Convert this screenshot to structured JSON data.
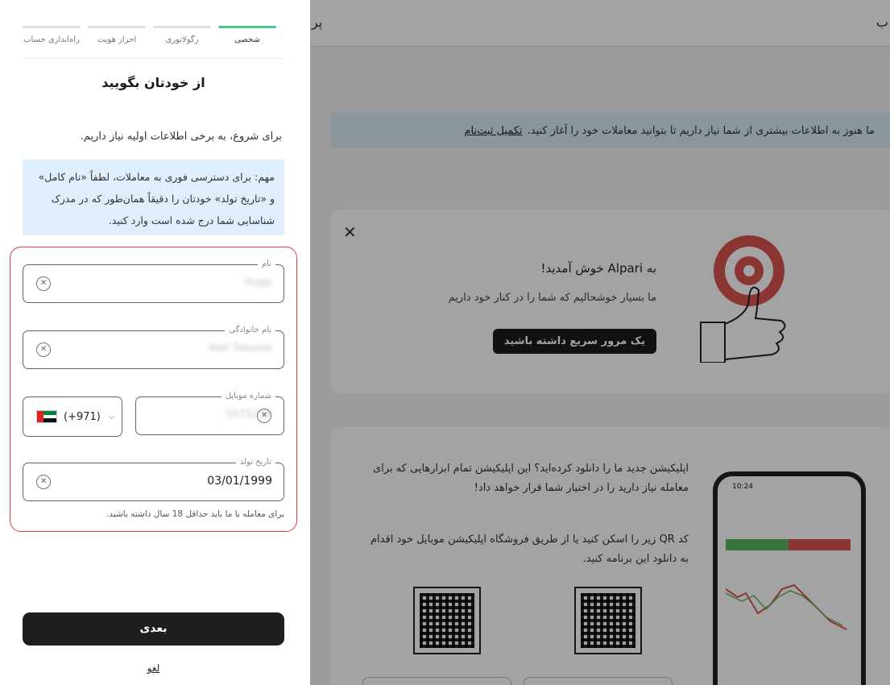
{
  "stepper": {
    "steps": [
      {
        "label": "شخصی",
        "active": true
      },
      {
        "label": "رگولاتوری",
        "active": false
      },
      {
        "label": "احراز هویت",
        "active": false
      },
      {
        "label": "راه‌اندازی حساب",
        "active": false
      }
    ],
    "accent": "#4cc98a"
  },
  "form": {
    "title": "از خودتان بگویید",
    "intro": "برای شروع، به برخی اطلاعات اولیه نیاز داریم.",
    "important_note": "مهم: برای دسترسی فوری به معاملات، لطفاً «نام کامل» و «تاریخ تولد» خودتان را دقیقاً همان‌طور که در مدرک شناسایی شما درج شده است وارد کنید.",
    "first_name": {
      "label": "نام",
      "value": "Hugo"
    },
    "last_name": {
      "label": "نام خانوادگی",
      "value": "Alef Tokooto"
    },
    "country_code": {
      "value": "(+971)",
      "flag": "uae-flag-icon"
    },
    "mobile": {
      "label": "شماره موبایل",
      "value": "5571234"
    },
    "dob": {
      "label": "تاریخ تولد",
      "value": "03/01/1999"
    },
    "age_note": "برای معامله با ما باید حداقل 18 سال داشته باشید.",
    "next_label": "بعدی",
    "cancel_label": "لغو",
    "highlight_color": "#e63946"
  },
  "background": {
    "header_frag_left": "پر",
    "header_frag_right": "ب",
    "notice_text": "ما هنوز به اطلاعات بیشتری از شما نیاز داریم تا بتوانید معاملات خود را آغاز کنید.",
    "notice_link": "تکمیل ثبت‌نام",
    "welcome_title": "به Alpari خوش آمدید!",
    "welcome_sub": "ما بسیار خوشحالیم که شما را در کنار خود داریم",
    "welcome_button": "یک مرور سریع داشته باشید",
    "app_text_1": "اپلیکیشن جدید ما را دانلود کرده‌اید؟ این اپلیکیشن تمام ابزارهایی که برای معامله نیاز دارید را در اختیار شما قرار خواهد داد!",
    "app_text_2": "کد QR زیر را اسکن کنید یا از طریق فروشگاه اپلیکیشن موبایل خود اقدام به دانلود این برنامه کنید.",
    "phone_time": "10:24"
  }
}
